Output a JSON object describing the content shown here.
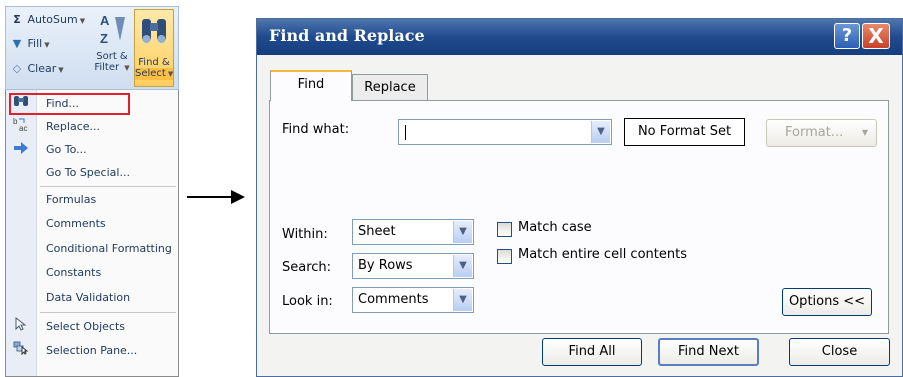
{
  "ribbon": {
    "autosum": "AutoSum",
    "fill": "Fill",
    "clear": "Clear",
    "sort_filter": [
      "Sort &",
      "Filter"
    ],
    "find_select": [
      "Find &",
      "Select"
    ]
  },
  "menu": {
    "items": [
      {
        "label": "Find...",
        "icon": "binoculars-icon"
      },
      {
        "label": "Replace...",
        "icon": "replace-icon"
      },
      {
        "label": "Go To...",
        "icon": "arrow-right-icon"
      },
      {
        "label": "Go To Special...",
        "icon": ""
      },
      {
        "label": "Formulas",
        "icon": ""
      },
      {
        "label": "Comments",
        "icon": ""
      },
      {
        "label": "Conditional Formatting",
        "icon": ""
      },
      {
        "label": "Constants",
        "icon": ""
      },
      {
        "label": "Data Validation",
        "icon": ""
      },
      {
        "label": "Select Objects",
        "icon": "cursor-icon"
      },
      {
        "label": "Selection Pane...",
        "icon": "selection-pane-icon"
      }
    ]
  },
  "dialog": {
    "title": "Find and Replace",
    "help": "?",
    "close_x": "X",
    "tabs": [
      "Find",
      "Replace"
    ],
    "find_what_label": "Find what:",
    "find_what_value": "",
    "no_format": "No Format Set",
    "format_button": "Format...",
    "within_label": "Within:",
    "within_value": "Sheet",
    "search_label": "Search:",
    "search_value": "By Rows",
    "lookin_label": "Look in:",
    "lookin_value": "Comments",
    "match_case": "Match case",
    "match_entire": "Match entire cell contents",
    "options_button": "Options <<",
    "find_all": "Find All",
    "find_next": "Find Next",
    "close_button": "Close"
  },
  "colors": {
    "titlebar": "#1f4a8c",
    "highlight_box": "#e0202a",
    "tab_accent": "#f3b83a"
  }
}
